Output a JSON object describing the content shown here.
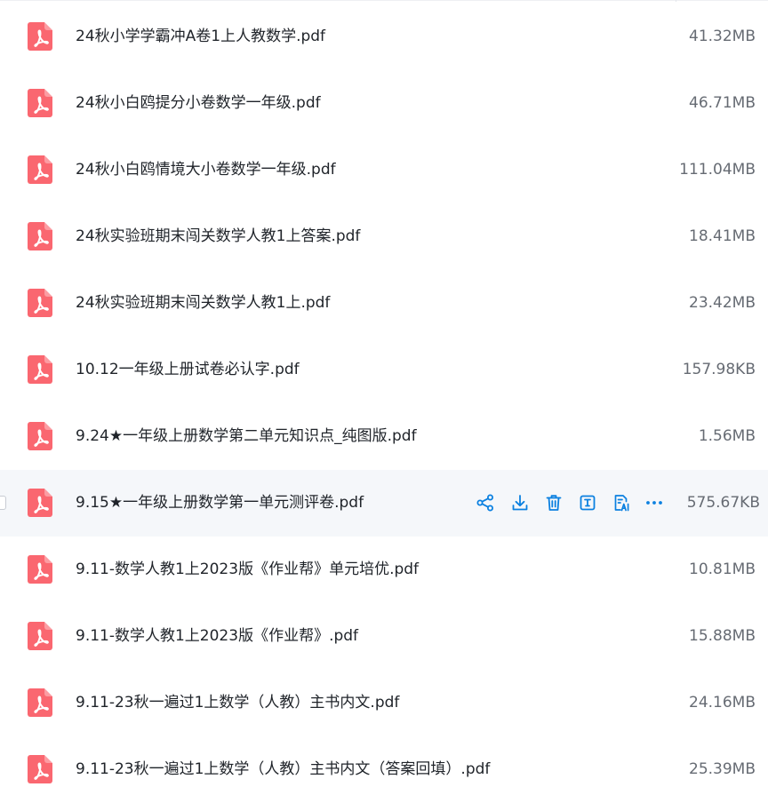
{
  "colors": {
    "pdf_icon": "#fa6770",
    "accent": "#0b80e0",
    "hover_row": "#f5f7fa",
    "text": "#1f2329",
    "size_text": "#666b73"
  },
  "hovered_index": 7,
  "row_actions": [
    {
      "icon": "share-icon"
    },
    {
      "icon": "download-icon"
    },
    {
      "icon": "delete-icon"
    },
    {
      "icon": "text-extract-icon"
    },
    {
      "icon": "ai-document-icon"
    },
    {
      "icon": "more-icon"
    }
  ],
  "files": [
    {
      "name": "24秋小学学霸冲A卷1上人教数学.pdf",
      "size": "41.32MB",
      "icon": "pdf-icon"
    },
    {
      "name": "24秋小白鸥提分小卷数学一年级.pdf",
      "size": "46.71MB",
      "icon": "pdf-icon"
    },
    {
      "name": "24秋小白鸥情境大小卷数学一年级.pdf",
      "size": "111.04MB",
      "icon": "pdf-icon"
    },
    {
      "name": "24秋实验班期末闯关数学人教1上答案.pdf",
      "size": "18.41MB",
      "icon": "pdf-icon"
    },
    {
      "name": "24秋实验班期末闯关数学人教1上.pdf",
      "size": "23.42MB",
      "icon": "pdf-icon"
    },
    {
      "name": "10.12一年级上册试卷必认字.pdf",
      "size": "157.98KB",
      "icon": "pdf-icon"
    },
    {
      "name": "9.24★一年级上册数学第二单元知识点_纯图版.pdf",
      "size": "1.56MB",
      "icon": "pdf-icon"
    },
    {
      "name": "9.15★一年级上册数学第一单元测评卷.pdf",
      "size": "575.67KB",
      "icon": "pdf-icon"
    },
    {
      "name": "9.11-数学人教1上2023版《作业帮》单元培优.pdf",
      "size": "10.81MB",
      "icon": "pdf-icon"
    },
    {
      "name": "9.11-数学人教1上2023版《作业帮》.pdf",
      "size": "15.88MB",
      "icon": "pdf-icon"
    },
    {
      "name": "9.11-23秋一遍过1上数学（人教）主书内文.pdf",
      "size": "24.16MB",
      "icon": "pdf-icon"
    },
    {
      "name": "9.11-23秋一遍过1上数学（人教）主书内文（答案回填）.pdf",
      "size": "25.39MB",
      "icon": "pdf-icon"
    }
  ]
}
